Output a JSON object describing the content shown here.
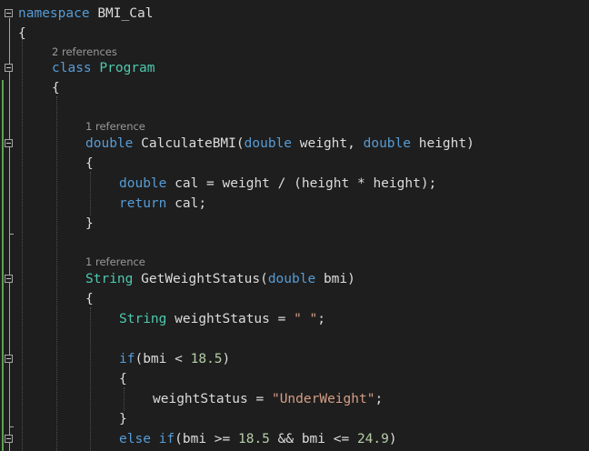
{
  "code_lens": {
    "program_refs": "2 references",
    "calc_refs": "1 reference",
    "status_refs": "1 reference"
  },
  "tokens": {
    "namespace": "namespace",
    "ns_name": "BMI_Cal",
    "class": "class",
    "class_name": "Program",
    "double": "double",
    "method_calc": "CalculateBMI",
    "param_weight": "weight",
    "param_height": "height",
    "var_cal": "cal",
    "return": "return",
    "string_type": "String",
    "method_status": "GetWeightStatus",
    "param_bmi": "bmi",
    "var_status": "weightStatus",
    "empty_str": "\" \"",
    "if": "if",
    "else": "else",
    "num_18_5": "18.5",
    "num_24_9": "24.9",
    "underweight_str": "\"UnderWeight\""
  },
  "colors": {
    "background": "#1e1e1e",
    "keyword": "#569cd6",
    "type": "#4ec9b0",
    "string": "#d69d85",
    "number": "#b5cea8",
    "text": "#dcdcdc",
    "code_lens": "#999999",
    "change_bar": "#57a64a"
  }
}
